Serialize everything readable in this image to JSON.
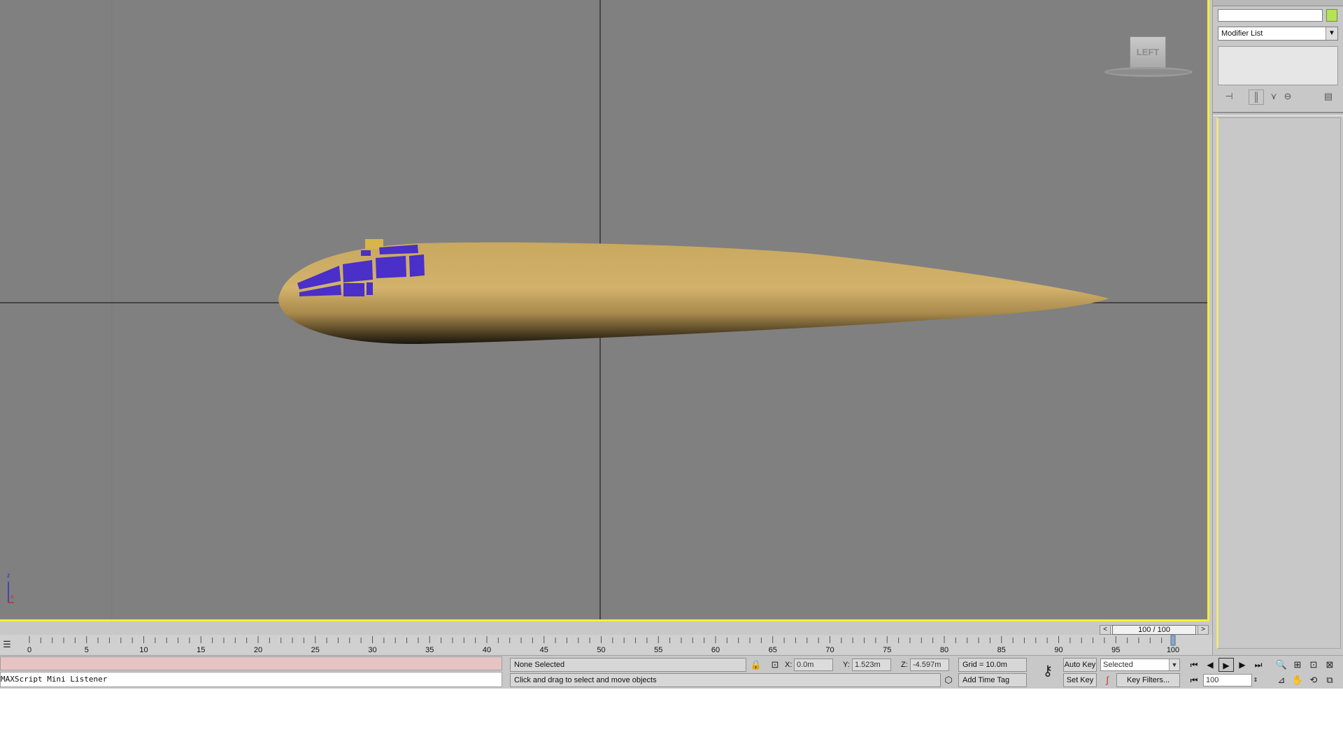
{
  "viewport": {
    "viewcube_label": "LEFT",
    "axis_z": "z",
    "axis_x": "x"
  },
  "command_panel": {
    "modifier_list_label": "Modifier List",
    "object_color": "#b6e25a"
  },
  "time_slider": {
    "label": "100 / 100"
  },
  "trackbar": {
    "ticks": [
      "0",
      "5",
      "10",
      "15",
      "20",
      "25",
      "30",
      "35",
      "40",
      "45",
      "50",
      "55",
      "60",
      "65",
      "70",
      "75",
      "80",
      "85",
      "90",
      "95",
      "100"
    ]
  },
  "status": {
    "listener_label": "MAXScript Mini Listener",
    "selection": "None Selected",
    "prompt": "Click and drag to select and move objects",
    "x_label": "X:",
    "x_value": "0.0m",
    "y_label": "Y:",
    "y_value": "1.523m",
    "z_label": "Z:",
    "z_value": "-4.597m",
    "grid": "Grid = 10.0m",
    "add_time_tag": "Add Time Tag",
    "auto_key": "Auto Key",
    "set_key": "Set Key",
    "key_mode": "Selected",
    "key_filters": "Key Filters...",
    "current_frame": "100"
  },
  "colors": {
    "viewport_bg": "#808080",
    "active_border": "#f3ee3a",
    "fuselage": "#c9a764",
    "windows": "#4a2fc8"
  }
}
